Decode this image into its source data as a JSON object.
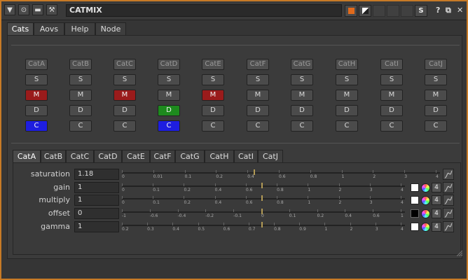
{
  "window": {
    "title": "CATMIX"
  },
  "titlebar": {
    "left_icons": [
      "collapse-arrow-icon",
      "node-settings-icon",
      "camera-icon",
      "wrench-icon"
    ],
    "right_buttons": [
      {
        "name": "orange-swatch-button",
        "label": ""
      },
      {
        "name": "split-view-button",
        "label": ""
      },
      {
        "name": "disabled-button-1",
        "label": ""
      },
      {
        "name": "disabled-button-2",
        "label": ""
      },
      {
        "name": "disabled-button-3",
        "label": ""
      },
      {
        "name": "s-button",
        "label": "S"
      }
    ],
    "help": "?",
    "float": "⧉",
    "close": "✕"
  },
  "tabs": [
    "Cats",
    "Aovs",
    "Help",
    "Node"
  ],
  "active_tab": "Cats",
  "cat_grid": {
    "columns": [
      "CatA",
      "CatB",
      "CatC",
      "CatD",
      "CatE",
      "CatF",
      "CatG",
      "CatH",
      "CatI",
      "CatJ"
    ],
    "rows": {
      "solo": "S",
      "mute": "M",
      "diffuse": "D",
      "color": "C"
    },
    "mute_active": [
      true,
      false,
      true,
      false,
      true,
      false,
      false,
      false,
      false,
      false
    ],
    "diffuse_active": [
      false,
      false,
      false,
      true,
      false,
      false,
      false,
      false,
      false,
      false
    ],
    "color_active": [
      true,
      false,
      false,
      true,
      false,
      false,
      false,
      false,
      false,
      false
    ],
    "colors": {
      "mute": "#9a1b1b",
      "diffuse": "#1d8a1d",
      "color": "#1e1ee0"
    }
  },
  "subtabs": [
    "CatA",
    "CatB",
    "CatC",
    "CatD",
    "CatE",
    "CatF",
    "CatG",
    "CatH",
    "CatI",
    "CatJ"
  ],
  "active_subtab": "CatA",
  "params": [
    {
      "label": "saturation",
      "value": "1.18",
      "ticks": [
        "0",
        "0.01",
        "0.1",
        "0.2",
        "0.4",
        "0.6",
        "0.8",
        "1",
        "2",
        "3",
        "4"
      ],
      "handle_fraction": 0.42,
      "swatch": "none",
      "has_four": false
    },
    {
      "label": "gain",
      "value": "1",
      "ticks": [
        "0",
        "0.1",
        "0.2",
        "0.4",
        "0.6",
        "0.8",
        "1",
        "2",
        "3",
        "4"
      ],
      "handle_fraction": 0.5,
      "swatch": "white",
      "has_four": true
    },
    {
      "label": "multiply",
      "value": "1",
      "ticks": [
        "0",
        "0.1",
        "0.2",
        "0.4",
        "0.6",
        "0.8",
        "1",
        "2",
        "3",
        "4"
      ],
      "handle_fraction": 0.5,
      "swatch": "white",
      "has_four": true
    },
    {
      "label": "offset",
      "value": "0",
      "ticks": [
        "-1",
        "-0.6",
        "-0.4",
        "-0.2",
        "-0.1",
        "0",
        "0.1",
        "0.2",
        "0.4",
        "0.6",
        "1"
      ],
      "handle_fraction": 0.5,
      "swatch": "black",
      "has_four": true
    },
    {
      "label": "gamma",
      "value": "1",
      "ticks": [
        "0.2",
        "0.3",
        "0.4",
        "0.5",
        "0.6",
        "0.7",
        "0.8",
        "0.9",
        "1",
        "2",
        "3",
        "4"
      ],
      "handle_fraction": 0.5,
      "swatch": "white",
      "has_four": true
    }
  ],
  "four_label": "4"
}
